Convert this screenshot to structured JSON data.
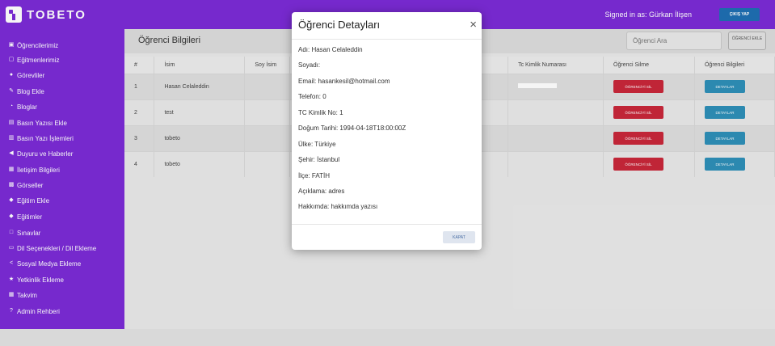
{
  "header": {
    "logo_text": "TOBETO",
    "signed_in": "Signed in as: Gürkan İlişen",
    "logout_label": "ÇIKIŞ YAP"
  },
  "sidebar": {
    "items": [
      {
        "label": "Öğrencilerimiz",
        "icon": "users-icon"
      },
      {
        "label": "Eğitmenlerimiz",
        "icon": "chat-icon"
      },
      {
        "label": "Görevliler",
        "icon": "user-icon"
      },
      {
        "label": "Blog Ekle",
        "icon": "edit-icon"
      },
      {
        "label": "Bloglar",
        "icon": "rss-icon"
      },
      {
        "label": "Basın Yazısı Ekle",
        "icon": "newspaper-icon"
      },
      {
        "label": "Basın Yazı İşlemleri",
        "icon": "document-icon"
      },
      {
        "label": "Duyuru ve Haberler",
        "icon": "megaphone-icon"
      },
      {
        "label": "İletişim Bilgileri",
        "icon": "contact-card-icon"
      },
      {
        "label": "Görseller",
        "icon": "image-icon"
      },
      {
        "label": "Eğitim Ekle",
        "icon": "graduation-cap-icon"
      },
      {
        "label": "Eğitimler",
        "icon": "graduation-cap-icon"
      },
      {
        "label": "Sınavlar",
        "icon": "monitor-icon"
      },
      {
        "label": "Dil Seçenekleri / Dil Ekleme",
        "icon": "language-icon"
      },
      {
        "label": "Sosyal Medya Ekleme",
        "icon": "share-icon"
      },
      {
        "label": "Yetkinlik Ekleme",
        "icon": "star-icon"
      },
      {
        "label": "Takvim",
        "icon": "calendar-icon"
      },
      {
        "label": "Admin Rehberi",
        "icon": "help-icon"
      }
    ]
  },
  "main": {
    "title": "Öğrenci Bilgileri",
    "search_placeholder": "Öğrenci Ara",
    "search_button": "ÖĞRENCİ EKLE"
  },
  "table": {
    "headers": [
      "#",
      "İsim",
      "Soy İsim",
      "",
      "Tc Kimlik Numarası",
      "Öğrenci Silme",
      "Öğrenci Bilgileri"
    ],
    "rows": [
      {
        "no": "1",
        "name": "Hasan Celaleddin",
        "surname": "",
        "delete": "ÖĞRENCİYİ SİL",
        "details": "DETAYLAR"
      },
      {
        "no": "2",
        "name": "test",
        "surname": "",
        "delete": "ÖĞRENCİYİ SİL",
        "details": "DETAYLAR"
      },
      {
        "no": "3",
        "name": "tobeto",
        "surname": "",
        "delete": "ÖĞRENCİYİ SİL",
        "details": "DETAYLAR"
      },
      {
        "no": "4",
        "name": "tobeto",
        "surname": "",
        "delete": "ÖĞRENCİYİ SİL",
        "details": "DETAYLAR"
      }
    ]
  },
  "modal": {
    "title": "Öğrenci Detayları",
    "close_symbol": "×",
    "fields": {
      "name": "Adı: Hasan Celaleddin",
      "surname": "Soyadı:",
      "email": "Email: hasankesil@hotmail.com",
      "phone": "Telefon: 0",
      "tc": "TC Kimlik No: 1",
      "birth": "Doğum Tarihi: 1994-04-18T18:00:00Z",
      "country": "Ülke: Türkiye",
      "city": "Şehir: İstanbul",
      "district": "İlçe: FATİH",
      "description": "Açıklama: adres",
      "about": "Hakkımda: hakkımda yazısı"
    },
    "close_button": "KAPAT"
  }
}
